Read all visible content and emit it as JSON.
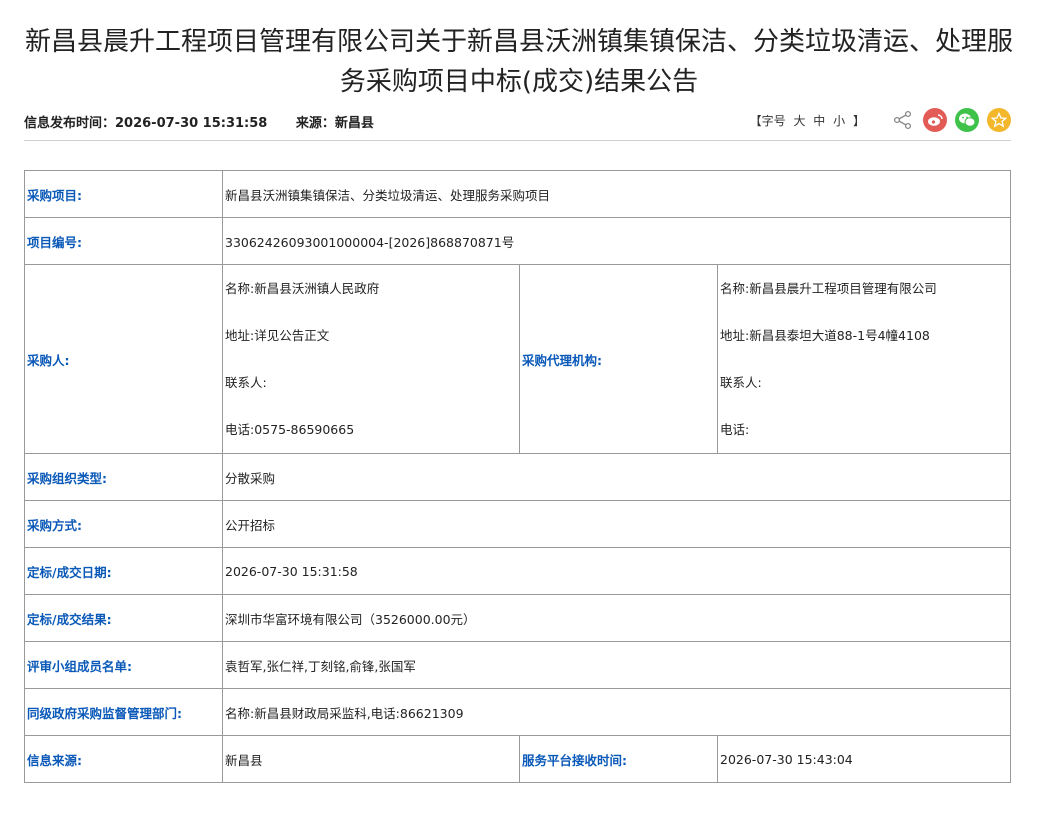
{
  "title": "新昌县晨升工程项目管理有限公司关于新昌县沃洲镇集镇保洁、分类垃圾清运、处理服务采购项目中标(成交)结果公告",
  "meta": {
    "publish": "信息发布时间：2026-07-30 15:31:58",
    "source": "来源：新昌县"
  },
  "tools": {
    "font_open": "【字号",
    "font_large": "大",
    "font_mid": "中",
    "font_small": "小",
    "font_close": "】"
  },
  "rows": {
    "project_k": "采购项目:",
    "project_v": "新昌县沃洲镇集镇保洁、分类垃圾清运、处理服务采购项目",
    "code_k": "项目编号:",
    "code_v": "33062426093001000004-[2026]868870871号",
    "buyer_k": "采购人:",
    "buyer_name": "名称:新昌县沃洲镇人民政府",
    "buyer_addr": "地址:详见公告正文",
    "buyer_contact": "联系人:",
    "buyer_phone": "电话:0575-86590665",
    "agency_k": "采购代理机构:",
    "agency_name": "名称:新昌县晨升工程项目管理有限公司",
    "agency_addr": "地址:新昌县泰坦大道88-1号4幢4108",
    "agency_contact": "联系人:",
    "agency_phone": "电话:",
    "org_k": "采购组织类型:",
    "org_v": "分散采购",
    "method_k": "采购方式:",
    "method_v": "公开招标",
    "date_k": "定标/成交日期:",
    "date_v": "2026-07-30 15:31:58",
    "result_k": "定标/成交结果:",
    "result_v": "深圳市华富环境有限公司（3526000.00元）",
    "panel_k": "评审小组成员名单:",
    "panel_v": "袁哲军,张仁祥,丁刻铭,俞锋,张国军",
    "dept_k": "同级政府采购监督管理部门:",
    "dept_v": "名称:新昌县财政局采监科,电话:86621309",
    "info_k": "信息来源:",
    "info_v": "新昌县",
    "recv_k": "服务平台接收时间:",
    "recv_v": "2026-07-30 15:43:04"
  }
}
